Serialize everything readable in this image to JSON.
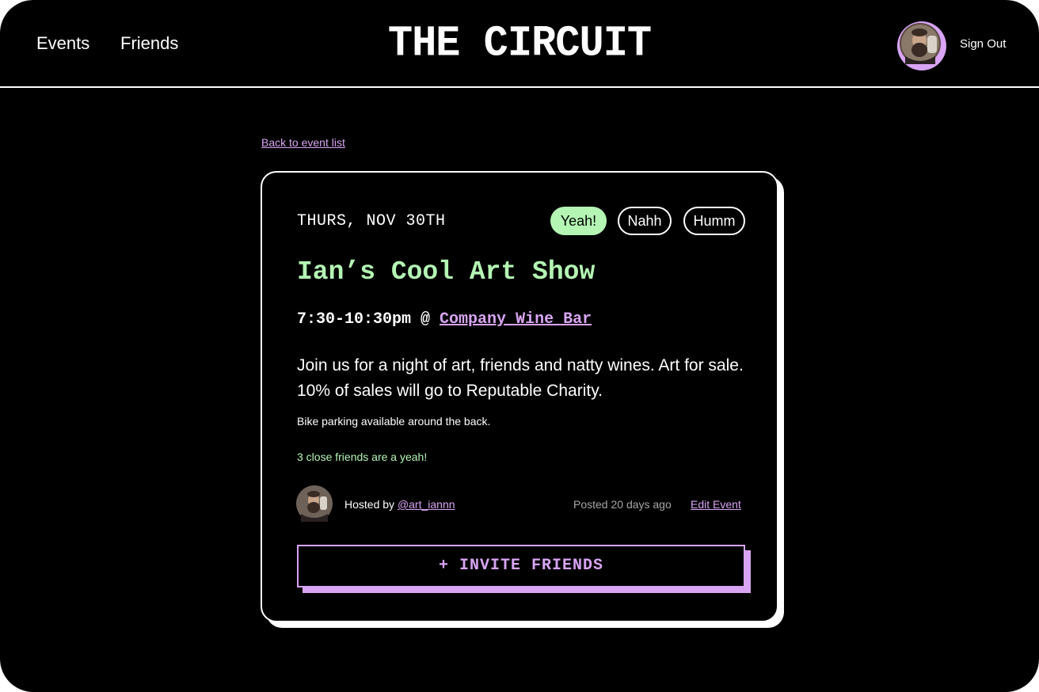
{
  "header": {
    "nav": {
      "events_label": "Events",
      "friends_label": "Friends"
    },
    "logo_text": "THE CIRCUIT",
    "sign_out_label": "Sign Out"
  },
  "back_link_label": "Back to event list",
  "event": {
    "date": "THURS, NOV 30TH",
    "rsvp": {
      "yeah_label": "Yeah!",
      "nahh_label": "Nahh",
      "humm_label": "Humm",
      "selected": "Yeah!"
    },
    "title": "Ian’s Cool Art Show",
    "time": "7:30-10:30pm",
    "at": " @ ",
    "venue": "Company Wine Bar",
    "description": "Join us for a night of art, friends and natty wines. Art for sale. 10% of sales will go to Reputable Charity.",
    "note": "Bike parking available around the back.",
    "friends_status": "3 close friends are a yeah!",
    "hosted_by_prefix": "Hosted by ",
    "host_handle": "@art_iannn",
    "posted_ago": "Posted 20 days ago",
    "edit_label": "Edit Event",
    "invite_label": "+ INVITE FRIENDS"
  },
  "colors": {
    "background": "#000000",
    "text": "#ffffff",
    "accent_green": "#b4f5b4",
    "accent_purple": "#d8a4f3",
    "muted": "#a6a6a6"
  },
  "icons": {
    "user_avatar": "user-avatar",
    "host_avatar": "host-avatar"
  }
}
